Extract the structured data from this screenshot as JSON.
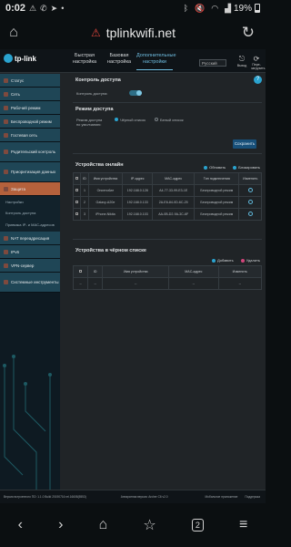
{
  "status": {
    "time": "0:02",
    "battery": "19%"
  },
  "browser": {
    "url": "tplinkwifi.net",
    "tab_count": "2"
  },
  "router": {
    "logo": "tp-link",
    "tabs": [
      {
        "label": "Быстрая настройка"
      },
      {
        "label": "Базовая настройка"
      },
      {
        "label": "Дополнительные настройки"
      }
    ],
    "language": "Русский",
    "header_icons": [
      {
        "label": "Выход"
      },
      {
        "label": "Пере-загрузить"
      }
    ],
    "sidebar": [
      {
        "label": "Статус",
        "icon": "status-icon"
      },
      {
        "label": "Сеть",
        "icon": "network-icon"
      },
      {
        "label": "Рабочий режим",
        "icon": "mode-icon"
      },
      {
        "label": "Беспроводной режим",
        "icon": "wireless-icon"
      },
      {
        "label": "Гостевая сеть",
        "icon": "guest-icon"
      },
      {
        "label": "Родительский контроль",
        "icon": "parental-icon"
      },
      {
        "label": "Приоритизация данных",
        "icon": "qos-icon"
      },
      {
        "label": "Защита",
        "icon": "shield-icon"
      },
      {
        "label": "NAT переадресация",
        "icon": "nat-icon"
      },
      {
        "label": "IPv6",
        "icon": "ipv6-icon"
      },
      {
        "label": "VPN-сервер",
        "icon": "vpn-icon"
      },
      {
        "label": "Системные инструменты",
        "icon": "tools-icon"
      }
    ],
    "subitems": [
      {
        "label": "Настройки"
      },
      {
        "label": "Контроль доступа"
      },
      {
        "label": "Привязка IP- и MAC-адресов"
      }
    ],
    "access": {
      "title": "Контроль доступа",
      "control_label": "Контроль доступа:",
      "mode_title": "Режим доступа",
      "default_label": "Режим доступа по умолчанию:",
      "opt_black": "Чёрный список",
      "opt_white": "Белый список",
      "save": "Сохранить"
    },
    "online": {
      "title": "Устройства онлайн",
      "refresh": "Обновить",
      "block": "Блокировать",
      "headers": [
        "ID",
        "Имя устройства",
        "IP-адрес",
        "MAC-адрес",
        "Тип подключения",
        "Изменить"
      ],
      "rows": [
        {
          "id": "1",
          "name": "Оnиeno6ze",
          "ip": "192.168.0.128",
          "mac": "A4-77-33-99-E3-1E",
          "type": "Беспроводной режим"
        },
        {
          "id": "2",
          "name": "Galaxy-A20e",
          "ip": "192.168.0.133",
          "mac": "2A-E6-84-0D-6C-25",
          "type": "Беспроводной режим"
        },
        {
          "id": "3",
          "name": "iPhone-Nikita",
          "ip": "192.168.0.103",
          "mac": "AA-0B-D2-9A-3C-6F",
          "type": "Беспроводной режим"
        }
      ]
    },
    "blacklist": {
      "title": "Устройства в чёрном списке",
      "add": "Добавить",
      "del": "Удалить",
      "headers": [
        "ID",
        "Имя устройства",
        "MAC-адрес",
        "Изменить"
      ],
      "rows": [
        {
          "id": "--",
          "name": "--",
          "mac": "--",
          "edit": "--"
        }
      ]
    },
    "footer": {
      "fw": "Версия встроенного ПО: 1.1.0 Build 20190716 rel.16608(5553)",
      "hw": "Аппаратная версия: Archer C6 v2.0",
      "app": "Мобильное приложение",
      "support": "Поддержка"
    }
  }
}
